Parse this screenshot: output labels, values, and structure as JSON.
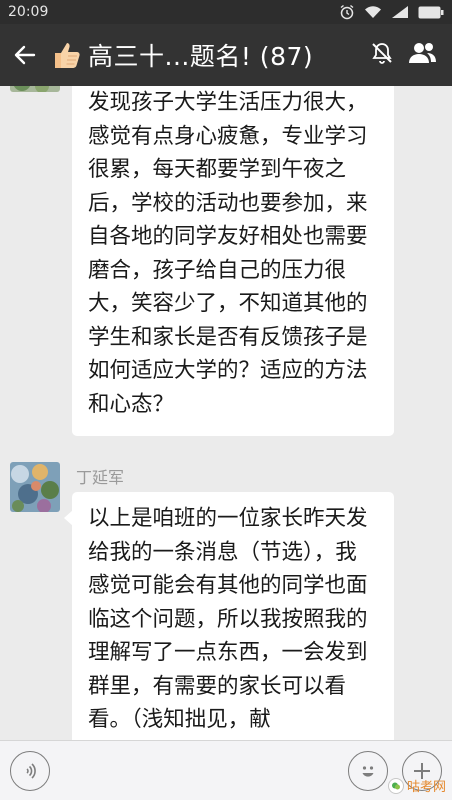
{
  "status_bar": {
    "time": "20:09",
    "battery": "100"
  },
  "header": {
    "title": "高三十...题名! (87)",
    "emoji_icon": "thumbs-up",
    "mute_icon": "bell-muted",
    "members_icon": "group-members"
  },
  "messages": [
    {
      "sender": "",
      "text": "发现孩子大学生活压力很大，感觉有点身心疲惫，专业学习很累，每天都要学到午夜之后，学校的活动也要参加，来自各地的同学友好相处也需要磨合，孩子给自己的压力很大，笑容少了，不知道其他的学生和家长是否有反馈孩子是如何适应大学的？适应的方法和心态？"
    },
    {
      "sender": "丁延军",
      "text": "以上是咱班的一位家长昨天发给我的一条消息（节选），我感觉可能会有其他的同学也面临这个问题，所以我按照我的理解写了一点东西，一会发到群里，有需要的家长可以看看。（浅知拙见，献"
    }
  ],
  "bottom_bar": {
    "voice_icon": "voice",
    "emoji_icon": "smiley",
    "plus_icon": "plus"
  },
  "watermark": {
    "text": "咕考网"
  },
  "colors": {
    "status_bg": "#2d2d2d",
    "title_bg": "#333333",
    "chat_bg": "#ebebeb",
    "bubble_bg": "#ffffff",
    "watermark": "#e58a30"
  }
}
